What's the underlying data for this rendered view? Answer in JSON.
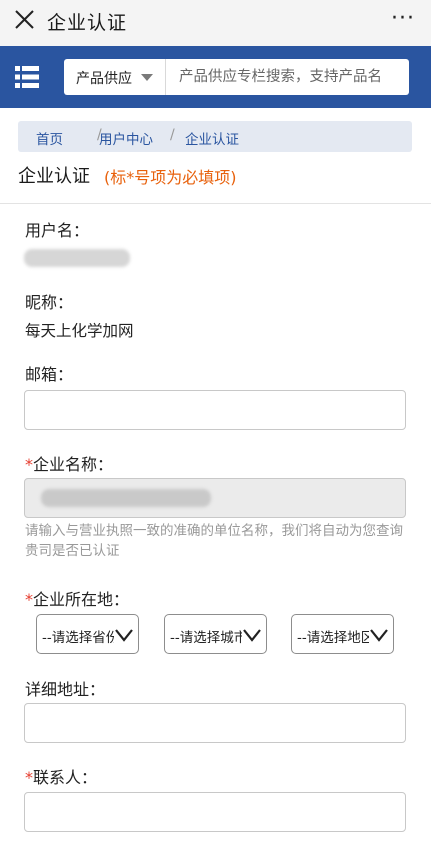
{
  "window": {
    "title": "企业认证",
    "more": "···"
  },
  "header": {
    "search": {
      "category": "产品供应",
      "placeholder": "产品供应专栏搜索，支持产品名"
    }
  },
  "breadcrumb": [
    "首页",
    "用户中心",
    "企业认证"
  ],
  "page": {
    "title": "企业认证",
    "note": "(标*号项为必填项)"
  },
  "form": {
    "username_label": "用户名：",
    "nickname_label": "昵称：",
    "nickname_value": "每天上化学加网",
    "email_label": "邮箱：",
    "company_label": "企业名称：",
    "company_hint": "请输入与营业执照一致的准确的单位名称，我们将自动为您查询贵司是否已认证",
    "location_label": "企业所在地：",
    "province_option": "--请选择省份",
    "city_option": "--请选择城市",
    "district_option": "--请选择地区",
    "address_label": "详细地址：",
    "contact_label": "联系人：",
    "required_mark": "*"
  }
}
